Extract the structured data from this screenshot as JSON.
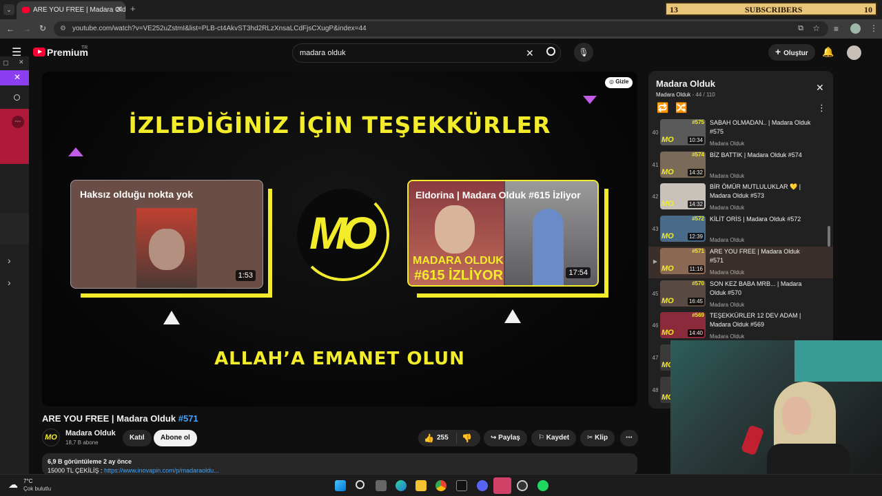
{
  "browser": {
    "tab_title": "ARE YOU FREE | Madara Olduk",
    "url": "youtube.com/watch?v=VE252uZstmI&list=PLB-ct4AkvST3hd2RLzXnsaLCdFjsCXugP&index=44"
  },
  "subscribers_widget": {
    "left": "13",
    "label": "SUBSCRIBERS",
    "right": "10"
  },
  "header": {
    "logo_text": "Premium",
    "logo_region": "TR",
    "search_value": "madara olduk",
    "create_label": "Oluştur"
  },
  "video": {
    "hide_label": "Gizle",
    "end_title": "İZLEDİĞİNİZ İÇİN TEŞEKKÜRLER",
    "end_footer": "ALLAH’A EMANET OLUN",
    "left_card": {
      "title": "Haksız olduğu nokta yok",
      "duration": "1:53"
    },
    "right_card": {
      "title": "Eldorina | Madara Olduk #615 İzliyor",
      "duration": "17:54",
      "thumb_text_1": "MADARA OLDUK",
      "thumb_text_2": "#615 İZLİYOR"
    },
    "logo_text": "MO"
  },
  "meta": {
    "title": "ARE YOU FREE | Madara Olduk",
    "hashtag": "#571",
    "channel": "Madara Olduk",
    "subs": "18,7 B abone",
    "join": "Katıl",
    "subscribe": "Abone ol",
    "likes": "255",
    "share": "Paylaş",
    "save": "Kaydet",
    "clip": "Klip",
    "views_line": "6,9 B görüntüleme  2 ay önce",
    "desc_prefix": "15000 TL ÇEKİLİŞ : ",
    "desc_link": "https://www.inovapin.com/p/madaraoldu..."
  },
  "playlist": {
    "title": "Madara Olduk",
    "channel": "Madara Olduk",
    "position": "44 / 110",
    "items": [
      {
        "idx": "40",
        "title": "SABAH OLMADAN.. | Madara Olduk #575",
        "channel": "Madara Olduk",
        "duration": "10:34",
        "num": "#575",
        "color": "#5a5a5a"
      },
      {
        "idx": "41",
        "title": "BİZ BATTIK | Madara Olduk #574",
        "channel": "Madara Olduk",
        "duration": "14:32",
        "num": "#574",
        "color": "#7a6a58"
      },
      {
        "idx": "42",
        "title": "BİR ÖMÜR MUTLULUKLAR 💛 | Madara Olduk #573",
        "channel": "Madara Olduk",
        "duration": "14:32",
        "num": "",
        "color": "#c9c2bb"
      },
      {
        "idx": "43",
        "title": "KİLİT ORİS | Madara Olduk #572",
        "channel": "Madara Olduk",
        "duration": "12:39",
        "num": "#572",
        "color": "#4a6a8a"
      },
      {
        "idx": "▶",
        "title": "ARE YOU FREE | Madara Olduk #571",
        "channel": "Madara Olduk",
        "duration": "11:16",
        "num": "#571",
        "color": "#8a6a55"
      },
      {
        "idx": "45",
        "title": "SON KEZ BABA MRB... | Madara Olduk #570",
        "channel": "Madara Olduk",
        "duration": "16:45",
        "num": "#570",
        "color": "#5a4a44"
      },
      {
        "idx": "46",
        "title": "TEŞEKKÜRLER 12 DEV ADAM | Madara Olduk #569",
        "channel": "Madara Olduk",
        "duration": "14:40",
        "num": "#569",
        "color": "#8a2a3a"
      },
      {
        "idx": "47",
        "title": "",
        "channel": "",
        "duration": "",
        "num": "",
        "color": "#3a3a3a"
      },
      {
        "idx": "48",
        "title": "",
        "channel": "",
        "duration": "",
        "num": "",
        "color": "#3a3a3a"
      }
    ]
  },
  "weather": {
    "temp": "7°C",
    "desc": "Çok bulutlu"
  },
  "colors": {
    "accent_yellow": "#f2ec2a",
    "yt_red": "#ff0033",
    "magenta": "#c05ce8",
    "link_blue": "#3ea6ff"
  }
}
